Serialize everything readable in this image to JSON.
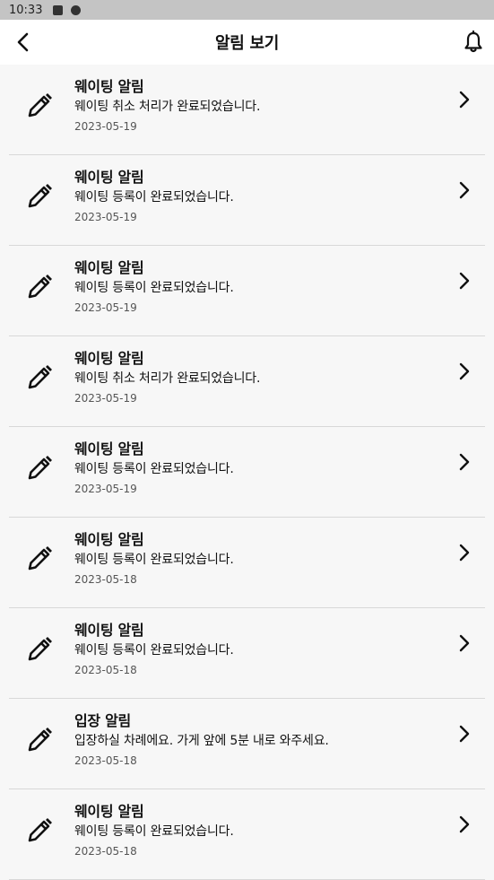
{
  "status_bar": {
    "time": "10:33"
  },
  "app_bar": {
    "title": "알림 보기",
    "back_icon": "back-arrow-icon",
    "bell_icon": "bell-icon"
  },
  "notifications": [
    {
      "title": "웨이팅 알림",
      "message": "웨이팅 취소 처리가 완료되었습니다.",
      "date": "2023-05-19"
    },
    {
      "title": "웨이팅 알림",
      "message": "웨이팅 등록이 완료되었습니다.",
      "date": "2023-05-19"
    },
    {
      "title": "웨이팅 알림",
      "message": "웨이팅 등록이 완료되었습니다.",
      "date": "2023-05-19"
    },
    {
      "title": "웨이팅 알림",
      "message": "웨이팅 취소 처리가 완료되었습니다.",
      "date": "2023-05-19"
    },
    {
      "title": "웨이팅 알림",
      "message": "웨이팅 등록이 완료되었습니다.",
      "date": "2023-05-19"
    },
    {
      "title": "웨이팅 알림",
      "message": "웨이팅 등록이 완료되었습니다.",
      "date": "2023-05-18"
    },
    {
      "title": "웨이팅 알림",
      "message": "웨이팅 등록이 완료되었습니다.",
      "date": "2023-05-18"
    },
    {
      "title": "입장 알림",
      "message": "입장하실 차례에요. 가게 앞에 5분 내로 와주세요.",
      "date": "2023-05-18"
    },
    {
      "title": "웨이팅 알림",
      "message": "웨이팅 등록이 완료되었습니다.",
      "date": "2023-05-18"
    }
  ]
}
